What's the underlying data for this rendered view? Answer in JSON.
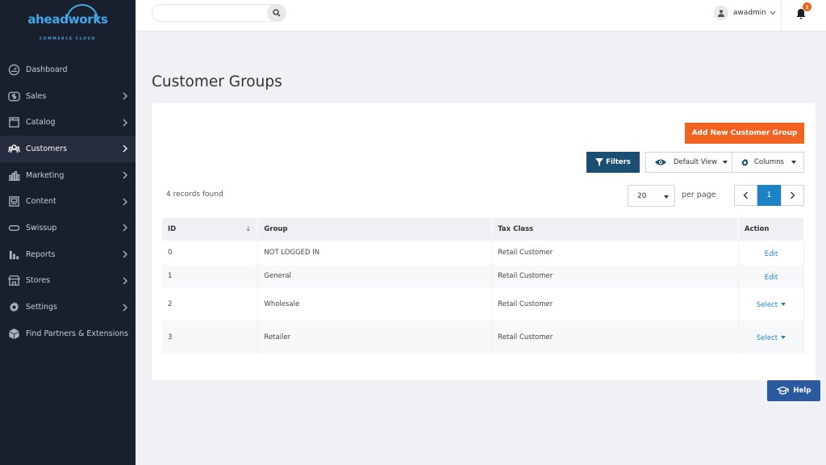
{
  "brand": {
    "name_part1": "ahead",
    "name_part2": "works",
    "tagline": "COMMERCE CLOUD"
  },
  "sidebar": {
    "items": [
      {
        "label": "Dashboard",
        "icon": "dashboard-icon",
        "has_chevron": false
      },
      {
        "label": "Sales",
        "icon": "dollar-icon",
        "has_chevron": true
      },
      {
        "label": "Catalog",
        "icon": "catalog-icon",
        "has_chevron": true
      },
      {
        "label": "Customers",
        "icon": "customers-icon",
        "has_chevron": true,
        "active": true
      },
      {
        "label": "Marketing",
        "icon": "marketing-icon",
        "has_chevron": true
      },
      {
        "label": "Content",
        "icon": "content-icon",
        "has_chevron": true
      },
      {
        "label": "Swissup",
        "icon": "swissup-icon",
        "has_chevron": true
      },
      {
        "label": "Reports",
        "icon": "reports-icon",
        "has_chevron": true
      },
      {
        "label": "Stores",
        "icon": "stores-icon",
        "has_chevron": true
      },
      {
        "label": "Settings",
        "icon": "gear-icon",
        "has_chevron": true
      },
      {
        "label": "Find Partners & Extensions",
        "icon": "extensions-icon",
        "has_chevron": false
      }
    ]
  },
  "header": {
    "search_placeholder": "",
    "username": "awadmin",
    "notification_count": "1"
  },
  "page": {
    "title": "Customer Groups",
    "add_button": "Add New Customer Group",
    "filters_button": "Filters",
    "view_button": "Default View",
    "columns_button": "Columns",
    "records_found": "4 records found",
    "per_page_value": "20",
    "per_page_label": "per page",
    "current_page": "1"
  },
  "table": {
    "headers": {
      "id": "ID",
      "group": "Group",
      "tax_class": "Tax Class",
      "action": "Action"
    },
    "rows": [
      {
        "id": "0",
        "group": "NOT LOGGED IN",
        "tax_class": "Retail Customer",
        "action": "Edit"
      },
      {
        "id": "1",
        "group": "General",
        "tax_class": "Retail Customer",
        "action": "Edit"
      },
      {
        "id": "2",
        "group": "Wholesale",
        "tax_class": "Retail Customer",
        "action": "Select"
      },
      {
        "id": "3",
        "group": "Retailer",
        "tax_class": "Retail Customer",
        "action": "Select"
      }
    ]
  },
  "help_button": "Help",
  "colors": {
    "accent": "#f26322",
    "primary": "#1b4f72",
    "link": "#1e83c6",
    "sidebar_bg": "#1a1f2e"
  }
}
